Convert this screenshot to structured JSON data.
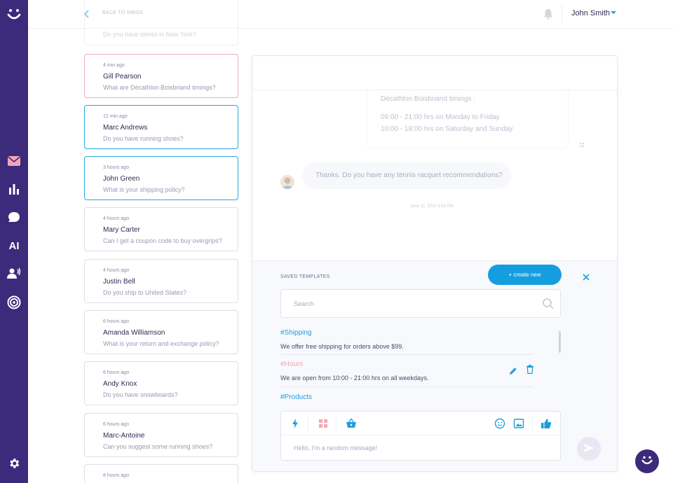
{
  "app": {
    "brand_color": "#3b2b7a",
    "accent": "#149ee0",
    "alert": "#f2aab3"
  },
  "sidebar": {
    "items": [
      {
        "icon": "mail-icon",
        "active": true
      },
      {
        "icon": "bar-chart-icon"
      },
      {
        "icon": "chat-bubble-icon"
      },
      {
        "icon": "ai-icon",
        "label": "AI"
      },
      {
        "icon": "user-voice-icon"
      },
      {
        "icon": "target-icon"
      },
      {
        "icon": "gear-icon"
      }
    ]
  },
  "topbar": {
    "back_label": "BACK TO INBOX",
    "user_name": "John Smith"
  },
  "conversations": [
    {
      "time": "",
      "name": "",
      "message": "Do you have stores in New York?",
      "state": "faded"
    },
    {
      "time": "4 min ago",
      "name": "Gill Pearson",
      "message": "What are Décathlon Boisbriand timings?",
      "state": "alert"
    },
    {
      "time": "12 min ago",
      "name": "Marc Andrews",
      "message": "Do you have running shoes?",
      "state": "selected"
    },
    {
      "time": "3 hours ago",
      "name": "John Green",
      "message": "What is your shipping policy?",
      "state": "selected"
    },
    {
      "time": "4 hours ago",
      "name": "Mary Carter",
      "message": "Can I get a coupon code to buy overgrips?",
      "state": "normal"
    },
    {
      "time": "4 hours ago",
      "name": "Justin Bell",
      "message": "Do you ship to United States?",
      "state": "normal"
    },
    {
      "time": "6 hours ago",
      "name": "Amanda Williamson",
      "message": "What is your return and exchange policy?",
      "state": "normal"
    },
    {
      "time": "6 hours ago",
      "name": "Andy Knox",
      "message": "Do you have snowboards?",
      "state": "normal"
    },
    {
      "time": "6 hours ago",
      "name": "Marc-Antoine",
      "message": "Can you suggest some running shoes?",
      "state": "normal"
    },
    {
      "time": "8 hours ago",
      "name": "",
      "message": "",
      "state": "normal"
    }
  ],
  "chat": {
    "agent_message": {
      "line1": "Décathlon Boisbriand timings :",
      "line2": "09:00 - 21:00 hrs on Monday to Friday",
      "line3": "10:00 - 18:00 hrs on Saturday and Sunday"
    },
    "customer_message": "Thanks. Do you have any tennis racquet recommendations?",
    "timestamp": "June 11, 2019 3:26 PM"
  },
  "templates": {
    "title": "SAVED TEMPLATES",
    "create_label": "+ create new",
    "search_placeholder": "Search",
    "items": [
      {
        "tag": "#Shipping",
        "body": "We offer free shipping for orders above $99."
      },
      {
        "tag": "#Hours",
        "body": "We are open from 10:00 - 21:00 hrs on all weekdays."
      },
      {
        "tag": "#Products",
        "body": ""
      }
    ]
  },
  "composer": {
    "placeholder": "Hello, I'm a random message!"
  }
}
